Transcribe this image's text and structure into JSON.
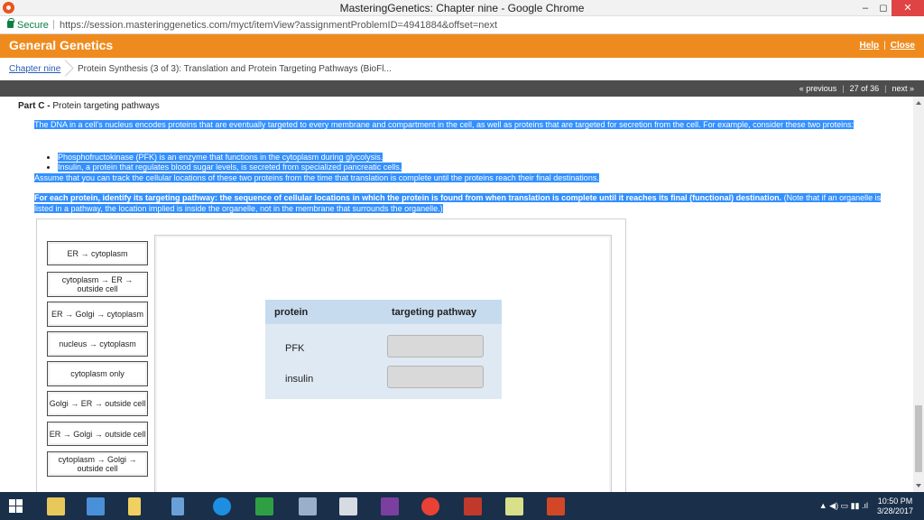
{
  "window": {
    "title": "MasteringGenetics: Chapter nine - Google Chrome",
    "minimize": "–",
    "maximize": "◻",
    "close": "✕"
  },
  "address": {
    "secure_label": "Secure",
    "separator": "|",
    "url": "https://session.masteringgenetics.com/myct/itemView?assignmentProblemID=4941884&offset=next"
  },
  "header": {
    "title": "General Genetics",
    "help": "Help",
    "close": "Close",
    "divider": "|"
  },
  "breadcrumb": {
    "chapter": "Chapter nine",
    "item": "Protein Synthesis (3 of 3): Translation and Protein Targeting Pathways (BioFl..."
  },
  "nav": {
    "previous": "« previous",
    "position": "27 of 36",
    "next": "next »",
    "divider": "|"
  },
  "part": {
    "label": "Part C -",
    "title": "Protein targeting pathways"
  },
  "problem": {
    "intro": "The DNA in a cell's nucleus encodes proteins that are eventually targeted to every membrane and compartment in the cell, as well as proteins that are targeted for secretion from the cell. For example, consider these two proteins:",
    "bullets": [
      "Phosphofructokinase (PFK) is an enzyme that functions in the cytoplasm during glycolysis.",
      "Insulin, a protein that regulates blood sugar levels, is secreted from specialized pancreatic cells."
    ],
    "assume": "Assume that you can track the cellular locations of these two proteins from the time that translation is complete until the proteins reach their final destinations.",
    "task_bold": "For each protein, identify its targeting pathway: the sequence of cellular locations in which the protein is found from when translation is complete until it reaches its final (functional) destination.",
    "task_note": " (Note that if an organelle is listed in a pathway, the location implied is inside the organelle, not in the membrane that surrounds the organelle.)"
  },
  "chips": [
    "ER → cytoplasm",
    "cytoplasm → ER → outside cell",
    "ER → Golgi → cytoplasm",
    "nucleus → cytoplasm",
    "cytoplasm only",
    "Golgi → ER → outside cell",
    "ER → Golgi → outside cell",
    "cytoplasm → Golgi → outside cell"
  ],
  "table": {
    "col_protein": "protein",
    "col_pathway": "targeting pathway",
    "row1": "PFK",
    "row2": "insulin"
  },
  "taskbar": {
    "time": "10:50 PM",
    "date": "3/28/2017"
  }
}
